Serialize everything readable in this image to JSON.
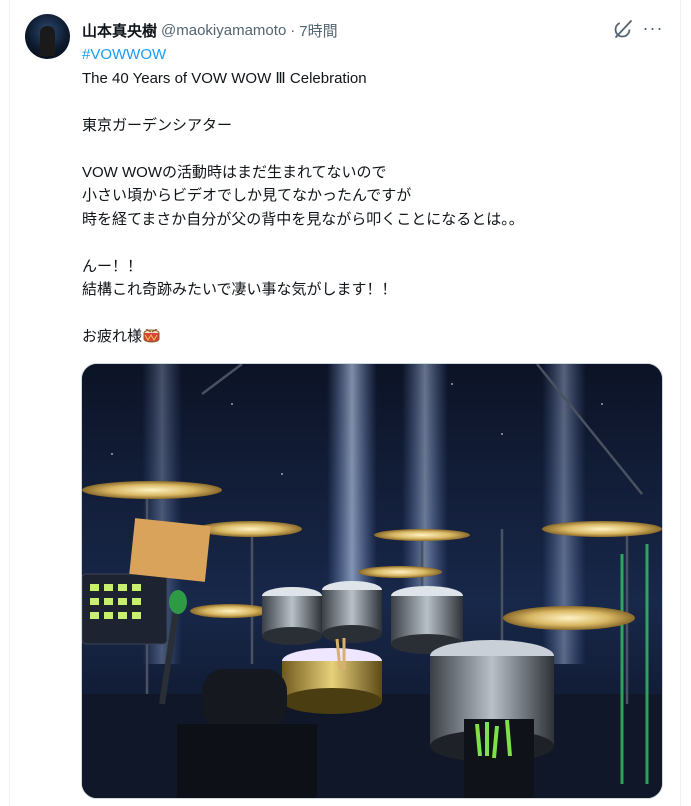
{
  "author": {
    "display_name": "山本真央樹",
    "handle": "@maokiyamamoto",
    "separator": "·",
    "time": "7時間"
  },
  "tweet": {
    "hashtag": "#VOWWOW",
    "lines": [
      "The 40 Years of VOW WOW Ⅲ Celebration",
      "",
      "東京ガーデンシアター",
      "",
      "VOW WOWの活動時はまだ生まれてないので",
      "小さい頃からビデオでしか見てなかったんですが",
      "時を経てまさか自分が父の背中を見ながら叩くことになるとは。。",
      "",
      "んー！！",
      "結構これ奇跡みたいで凄い事な気がします！！",
      "",
      "お疲れ様"
    ],
    "emoji": "drum-emoji"
  },
  "icons": {
    "grok": "grok-icon",
    "more": "more-icon",
    "more_glyph": "···"
  },
  "colors": {
    "text": "#0f1419",
    "secondary": "#536471",
    "link": "#1d9bf0"
  }
}
